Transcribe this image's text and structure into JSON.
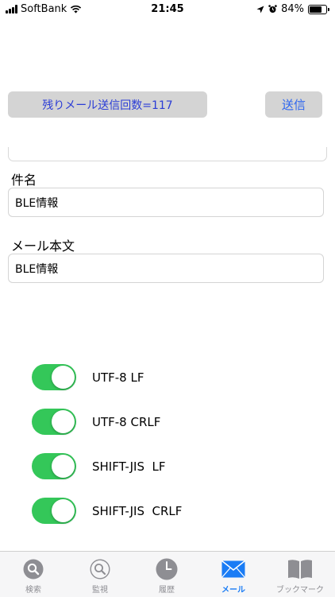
{
  "status_bar": {
    "carrier": "SoftBank",
    "time": "21:45",
    "battery_percent": "84%",
    "battery_level": 0.84
  },
  "counter_button": {
    "label": "残りメール送信回数=117"
  },
  "send_button": {
    "label": "送信"
  },
  "subject": {
    "label": "件名",
    "value": "BLE情報"
  },
  "body": {
    "label": "メール本文",
    "value": "BLE情報"
  },
  "toggles": [
    {
      "label": "UTF-8 LF",
      "on": true
    },
    {
      "label": "UTF-8 CRLF",
      "on": true
    },
    {
      "label": "SHIFT-JIS  LF",
      "on": true
    },
    {
      "label": "SHIFT-JIS  CRLF",
      "on": true
    }
  ],
  "tabs": [
    {
      "label": "検索",
      "icon": "search-icon"
    },
    {
      "label": "監視",
      "icon": "monitor-icon"
    },
    {
      "label": "履歴",
      "icon": "clock-icon"
    },
    {
      "label": "メール",
      "icon": "mail-icon",
      "active": true
    },
    {
      "label": "ブックマーク",
      "icon": "bookmark-icon"
    }
  ],
  "colors": {
    "accent": "#1a7cf5",
    "toggle_on": "#34c759",
    "button_bg": "#d4d4d4"
  }
}
